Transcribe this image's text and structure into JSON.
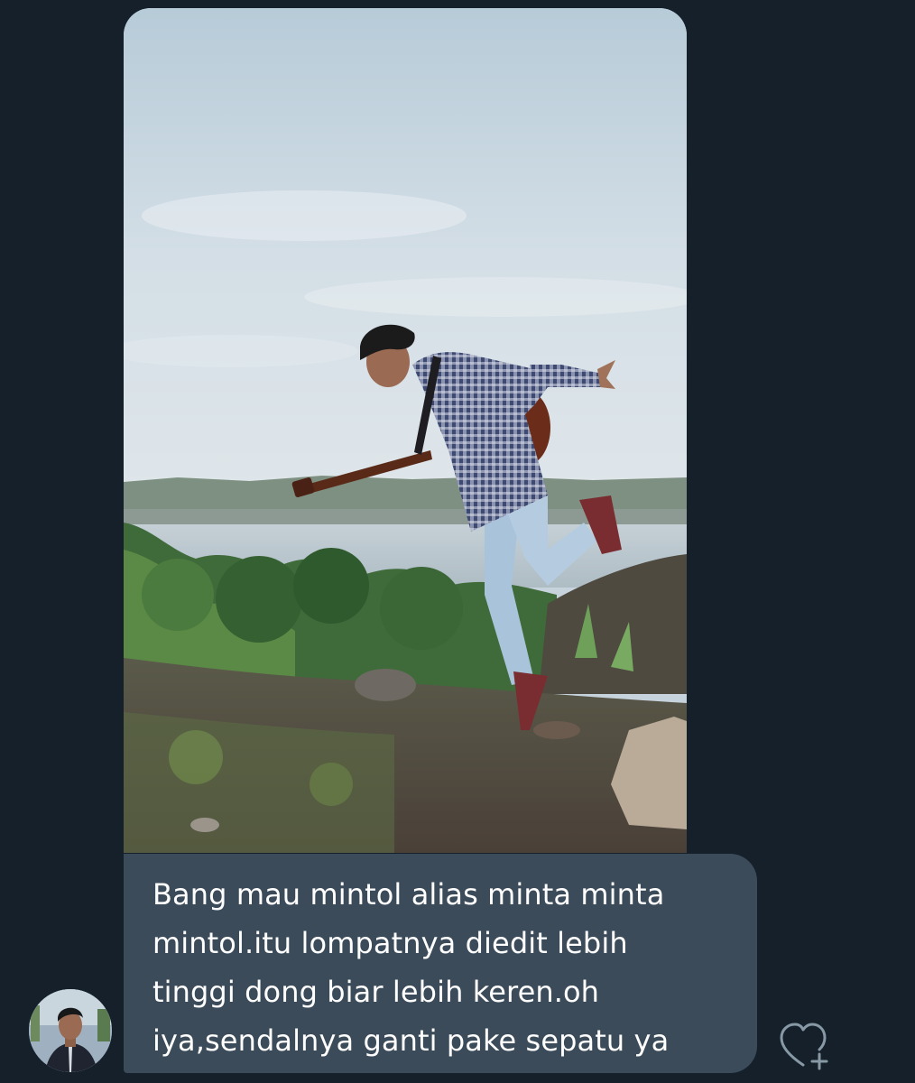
{
  "conversation": {
    "message": {
      "lines": [
        "Bang mau mintol alias minta minta",
        "mintol.itu lompatnya diedit lebih",
        "tinggi dong biar lebih keren.oh",
        "iya,sendalnya ganti pake sepatu ya"
      ]
    },
    "react_icon": "heart-plus-icon",
    "avatar_icon": "avatar"
  },
  "colors": {
    "background": "#15202b",
    "bubble": "#3b4b5a",
    "text": "#ffffff",
    "icon": "#8899a6"
  }
}
